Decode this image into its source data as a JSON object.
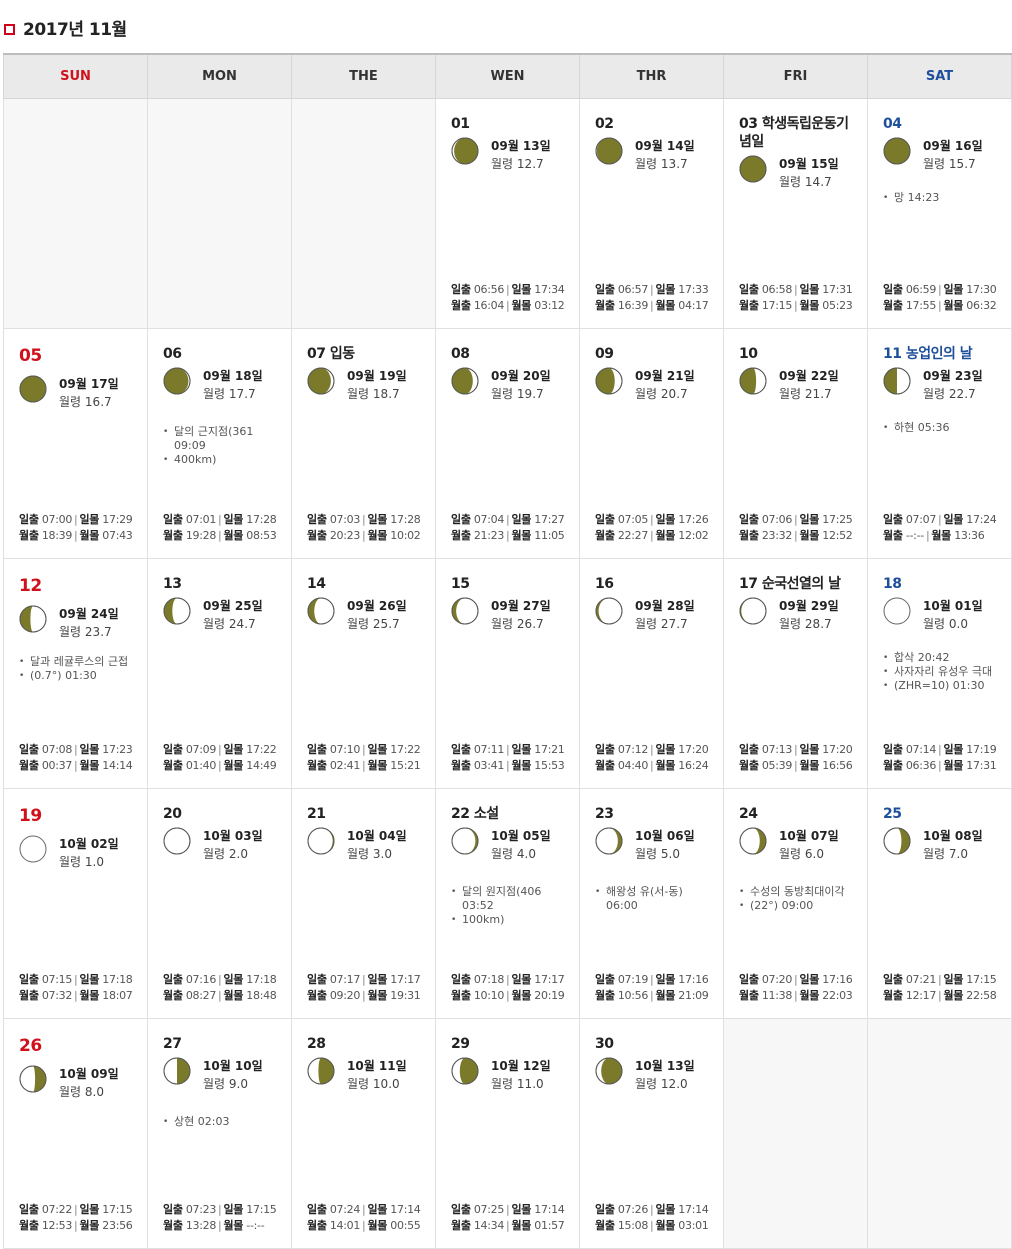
{
  "title": "2017년 11월",
  "weekdays": [
    "SUN",
    "MON",
    "THE",
    "WEN",
    "THR",
    "FRI",
    "SAT"
  ],
  "labels": {
    "sunrise": "일출",
    "sunset": "일몰",
    "moonrise": "월출",
    "moonset": "월몰",
    "age": "월령"
  },
  "moon_color": "#7b7a2a",
  "weeks": [
    [
      null,
      null,
      null,
      {
        "day": "01",
        "lunar": "09월 13일",
        "age": "12.7",
        "phase": 0.92,
        "waxing": true,
        "events": [],
        "sunrise": "06:56",
        "sunset": "17:34",
        "moonrise": "16:04",
        "moonset": "03:12"
      },
      {
        "day": "02",
        "lunar": "09월 14일",
        "age": "13.7",
        "phase": 0.97,
        "waxing": true,
        "events": [],
        "sunrise": "06:57",
        "sunset": "17:33",
        "moonrise": "16:39",
        "moonset": "04:17"
      },
      {
        "day": "03 학생독립운동기념일",
        "lunar": "09월 15일",
        "age": "14.7",
        "phase": 1.0,
        "waxing": true,
        "events": [],
        "sunrise": "06:58",
        "sunset": "17:31",
        "moonrise": "17:15",
        "moonset": "05:23"
      },
      {
        "day": "04",
        "lunar": "09월 16일",
        "age": "15.7",
        "phase": 1.0,
        "waxing": false,
        "events": [
          "망 14:23"
        ],
        "sunrise": "06:59",
        "sunset": "17:30",
        "moonrise": "17:55",
        "moonset": "06:32"
      }
    ],
    [
      {
        "day": "05",
        "lunar": "09월 17일",
        "age": "16.7",
        "phase": 0.98,
        "waxing": false,
        "events": [],
        "sunrise": "07:00",
        "sunset": "17:29",
        "moonrise": "18:39",
        "moonset": "07:43"
      },
      {
        "day": "06",
        "lunar": "09월 18일",
        "age": "17.7",
        "phase": 0.94,
        "waxing": false,
        "events": [
          "달의 근지점(361 09:09",
          "400km)"
        ],
        "sunrise": "07:01",
        "sunset": "17:28",
        "moonrise": "19:28",
        "moonset": "08:53"
      },
      {
        "day": "07 입동",
        "lunar": "09월 19일",
        "age": "18.7",
        "phase": 0.88,
        "waxing": false,
        "events": [],
        "sunrise": "07:03",
        "sunset": "17:28",
        "moonrise": "20:23",
        "moonset": "10:02"
      },
      {
        "day": "08",
        "lunar": "09월 20일",
        "age": "19.7",
        "phase": 0.8,
        "waxing": false,
        "events": [],
        "sunrise": "07:04",
        "sunset": "17:27",
        "moonrise": "21:23",
        "moonset": "11:05"
      },
      {
        "day": "09",
        "lunar": "09월 21일",
        "age": "20.7",
        "phase": 0.72,
        "waxing": false,
        "events": [],
        "sunrise": "07:05",
        "sunset": "17:26",
        "moonrise": "22:27",
        "moonset": "12:02"
      },
      {
        "day": "10",
        "lunar": "09월 22일",
        "age": "21.7",
        "phase": 0.62,
        "waxing": false,
        "events": [],
        "sunrise": "07:06",
        "sunset": "17:25",
        "moonrise": "23:32",
        "moonset": "12:52"
      },
      {
        "day": "11 농업인의 날",
        "lunar": "09월 23일",
        "age": "22.7",
        "phase": 0.5,
        "waxing": false,
        "events": [
          "하현 05:36"
        ],
        "sunrise": "07:07",
        "sunset": "17:24",
        "moonrise": "--:--",
        "moonset": "13:36"
      }
    ],
    [
      {
        "day": "12",
        "lunar": "09월 24일",
        "age": "23.7",
        "phase": 0.4,
        "waxing": false,
        "events": [
          "달과 레귤루스의 근접",
          "(0.7°) 01:30"
        ],
        "sunrise": "07:08",
        "sunset": "17:23",
        "moonrise": "00:37",
        "moonset": "14:14"
      },
      {
        "day": "13",
        "lunar": "09월 25일",
        "age": "24.7",
        "phase": 0.32,
        "waxing": false,
        "events": [],
        "sunrise": "07:09",
        "sunset": "17:22",
        "moonrise": "01:40",
        "moonset": "14:49"
      },
      {
        "day": "14",
        "lunar": "09월 26일",
        "age": "25.7",
        "phase": 0.24,
        "waxing": false,
        "events": [],
        "sunrise": "07:10",
        "sunset": "17:22",
        "moonrise": "02:41",
        "moonset": "15:21"
      },
      {
        "day": "15",
        "lunar": "09월 27일",
        "age": "26.7",
        "phase": 0.16,
        "waxing": false,
        "events": [],
        "sunrise": "07:11",
        "sunset": "17:21",
        "moonrise": "03:41",
        "moonset": "15:53"
      },
      {
        "day": "16",
        "lunar": "09월 28일",
        "age": "27.7",
        "phase": 0.1,
        "waxing": false,
        "events": [],
        "sunrise": "07:12",
        "sunset": "17:20",
        "moonrise": "04:40",
        "moonset": "16:24"
      },
      {
        "day": "17 순국선열의 날",
        "lunar": "09월 29일",
        "age": "28.7",
        "phase": 0.05,
        "waxing": false,
        "events": [],
        "sunrise": "07:13",
        "sunset": "17:20",
        "moonrise": "05:39",
        "moonset": "16:56"
      },
      {
        "day": "18",
        "lunar": "10월 01일",
        "age": "0.0",
        "phase": 0.0,
        "waxing": true,
        "events": [
          "합삭 20:42",
          "사자자리 유성우 극대",
          "(ZHR=10) 01:30"
        ],
        "sunrise": "07:14",
        "sunset": "17:19",
        "moonrise": "06:36",
        "moonset": "17:31"
      }
    ],
    [
      {
        "day": "19",
        "lunar": "10월 02일",
        "age": "1.0",
        "phase": 0.0,
        "waxing": true,
        "events": [],
        "sunrise": "07:15",
        "sunset": "17:18",
        "moonrise": "07:32",
        "moonset": "18:07"
      },
      {
        "day": "20",
        "lunar": "10월 03일",
        "age": "2.0",
        "phase": 0.02,
        "waxing": true,
        "events": [],
        "sunrise": "07:16",
        "sunset": "17:18",
        "moonrise": "08:27",
        "moonset": "18:48"
      },
      {
        "day": "21",
        "lunar": "10월 04일",
        "age": "3.0",
        "phase": 0.05,
        "waxing": true,
        "events": [],
        "sunrise": "07:17",
        "sunset": "17:17",
        "moonrise": "09:20",
        "moonset": "19:31"
      },
      {
        "day": "22 소설",
        "lunar": "10월 05일",
        "age": "4.0",
        "phase": 0.1,
        "waxing": true,
        "events": [
          "달의 원지점(406 03:52",
          "100km)"
        ],
        "sunrise": "07:18",
        "sunset": "17:17",
        "moonrise": "10:10",
        "moonset": "20:19"
      },
      {
        "day": "23",
        "lunar": "10월 06일",
        "age": "5.0",
        "phase": 0.16,
        "waxing": true,
        "events": [
          "해왕성 유(서-동) 06:00"
        ],
        "sunrise": "07:19",
        "sunset": "17:16",
        "moonrise": "10:56",
        "moonset": "21:09"
      },
      {
        "day": "24",
        "lunar": "10월 07일",
        "age": "6.0",
        "phase": 0.24,
        "waxing": true,
        "events": [
          "수성의 동방최대이각",
          "(22°) 09:00"
        ],
        "sunrise": "07:20",
        "sunset": "17:16",
        "moonrise": "11:38",
        "moonset": "22:03"
      },
      {
        "day": "25",
        "lunar": "10월 08일",
        "age": "7.0",
        "phase": 0.33,
        "waxing": true,
        "events": [],
        "sunrise": "07:21",
        "sunset": "17:15",
        "moonrise": "12:17",
        "moonset": "22:58"
      }
    ],
    [
      {
        "day": "26",
        "lunar": "10월 09일",
        "age": "8.0",
        "phase": 0.42,
        "waxing": true,
        "events": [],
        "sunrise": "07:22",
        "sunset": "17:15",
        "moonrise": "12:53",
        "moonset": "23:56"
      },
      {
        "day": "27",
        "lunar": "10월 10일",
        "age": "9.0",
        "phase": 0.5,
        "waxing": true,
        "events": [
          "상현 02:03"
        ],
        "sunrise": "07:23",
        "sunset": "17:15",
        "moonrise": "13:28",
        "moonset": "--:--"
      },
      {
        "day": "28",
        "lunar": "10월 11일",
        "age": "10.0",
        "phase": 0.6,
        "waxing": true,
        "events": [],
        "sunrise": "07:24",
        "sunset": "17:14",
        "moonrise": "14:01",
        "moonset": "00:55"
      },
      {
        "day": "29",
        "lunar": "10월 12일",
        "age": "11.0",
        "phase": 0.7,
        "waxing": true,
        "events": [],
        "sunrise": "07:25",
        "sunset": "17:14",
        "moonrise": "14:34",
        "moonset": "01:57"
      },
      {
        "day": "30",
        "lunar": "10월 13일",
        "age": "12.0",
        "phase": 0.8,
        "waxing": true,
        "events": [],
        "sunrise": "07:26",
        "sunset": "17:14",
        "moonrise": "15:08",
        "moonset": "03:01"
      },
      null,
      null
    ]
  ]
}
